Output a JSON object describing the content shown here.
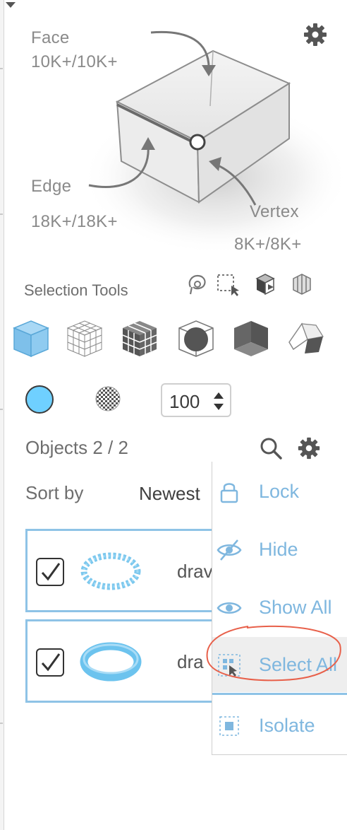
{
  "diagram": {
    "face_label": "Face",
    "face_count": "10K+/10K+",
    "edge_label": "Edge",
    "edge_count": "18K+/18K+",
    "vertex_label": "Vertex",
    "vertex_count": "8K+/8K+"
  },
  "selection_tools": {
    "title": "Selection Tools",
    "mini_tools": [
      "lasso-select-icon",
      "box-select-icon",
      "cube-arrow-icon",
      "cube-slices-icon"
    ],
    "mode_tools": [
      "solid-cube-icon",
      "wire-grid-cube-icon",
      "dark-grid-cube-icon",
      "sphere-in-cube-icon",
      "split-cube-icon",
      "open-planes-icon"
    ]
  },
  "display": {
    "color": "#6fd0ff",
    "value": "100"
  },
  "objects": {
    "title": "Objects 2 / 2",
    "sort_label": "Sort by",
    "sort_value": "Newest",
    "rows": [
      {
        "name": "drav",
        "checked": true,
        "thumb": "dotted-ring"
      },
      {
        "name": "dra",
        "checked": true,
        "thumb": "solid-ring"
      }
    ]
  },
  "context_menu": {
    "items": [
      {
        "label": "Lock",
        "icon": "lock-icon"
      },
      {
        "label": "Hide",
        "icon": "eye-slash-icon"
      },
      {
        "label": "Show All",
        "icon": "eye-icon"
      },
      {
        "label": "Select All",
        "icon": "select-all-icon"
      },
      {
        "label": "Isolate",
        "icon": "isolate-icon"
      }
    ]
  },
  "colors": {
    "accent": "#7fb7df",
    "row_border": "#8ec3e6",
    "annotation": "#e8604a"
  }
}
